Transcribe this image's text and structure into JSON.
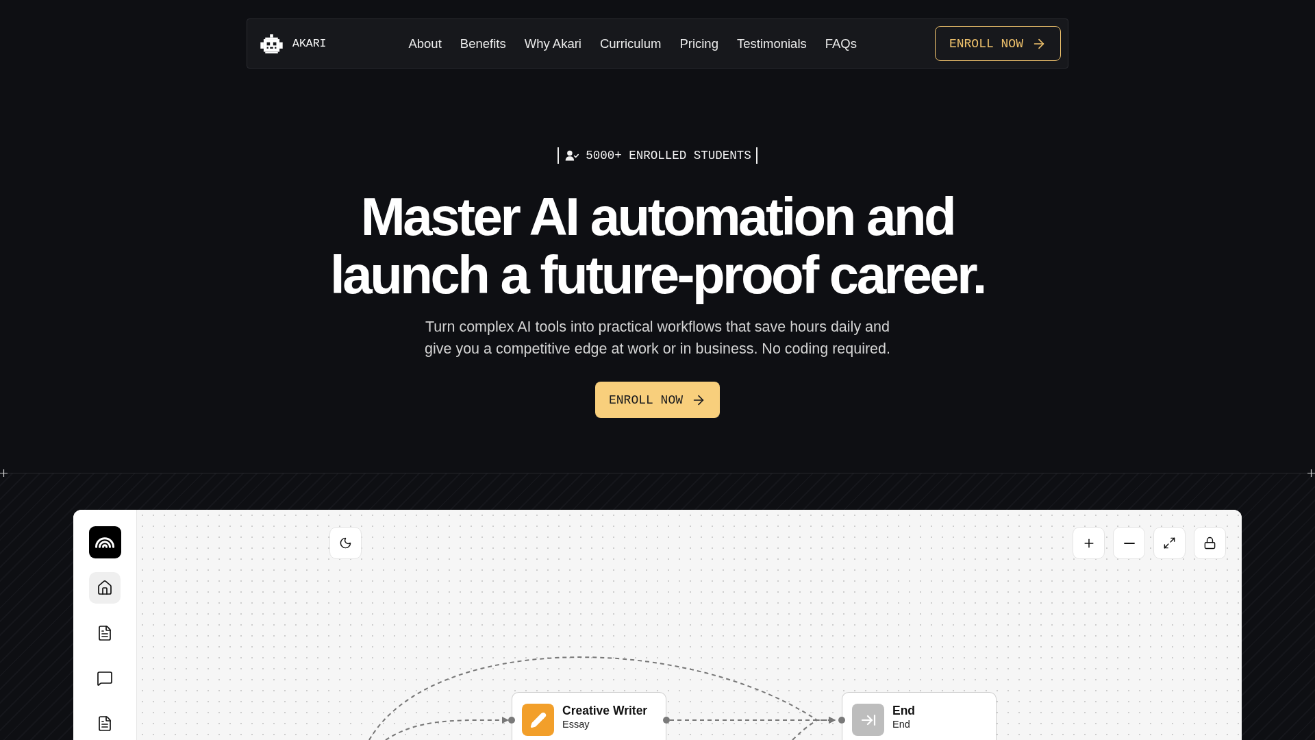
{
  "nav": {
    "brand": "AKARI",
    "links": [
      "About",
      "Benefits",
      "Why Akari",
      "Curriculum",
      "Pricing",
      "Testimonials",
      "FAQs"
    ],
    "cta": "ENROLL NOW"
  },
  "hero": {
    "badge": "5000+ ENROLLED STUDENTS",
    "title": "Master AI automation and launch a future-proof career.",
    "subtitle": "Turn complex AI tools into practical workflows that save hours daily and give you a competitive edge at work or in business. No coding required.",
    "cta": "ENROLL NOW"
  },
  "app": {
    "sidebar": {
      "items": [
        {
          "selected": true
        },
        {
          "selected": false
        },
        {
          "selected": false
        },
        {
          "selected": false
        }
      ]
    },
    "nodes": [
      {
        "kind": "step",
        "title": "Creative Writer",
        "subtitle": "Essay",
        "color": "#f29f2a"
      },
      {
        "kind": "end",
        "title": "End",
        "subtitle": "End",
        "color": "#bdbdbd"
      }
    ]
  }
}
